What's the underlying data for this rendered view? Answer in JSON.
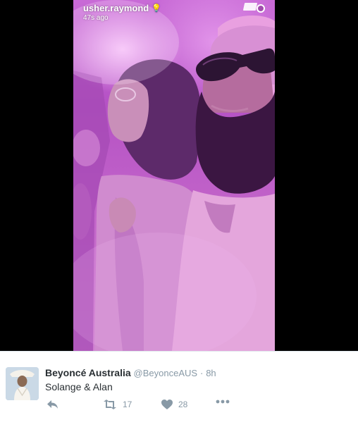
{
  "snap": {
    "username": "usher.raymond",
    "timestamp": "47s ago"
  },
  "tweet": {
    "display_name": "Beyoncé Australia",
    "handle": "@BeyonceAUS",
    "separator": "·",
    "time": "8h",
    "text": "Solange & Alan",
    "retweet_count": "17",
    "like_count": "28"
  },
  "colors": {
    "snap_tint": "#c264c9",
    "action_gray": "#8899a6",
    "text_dark": "#292f33"
  }
}
